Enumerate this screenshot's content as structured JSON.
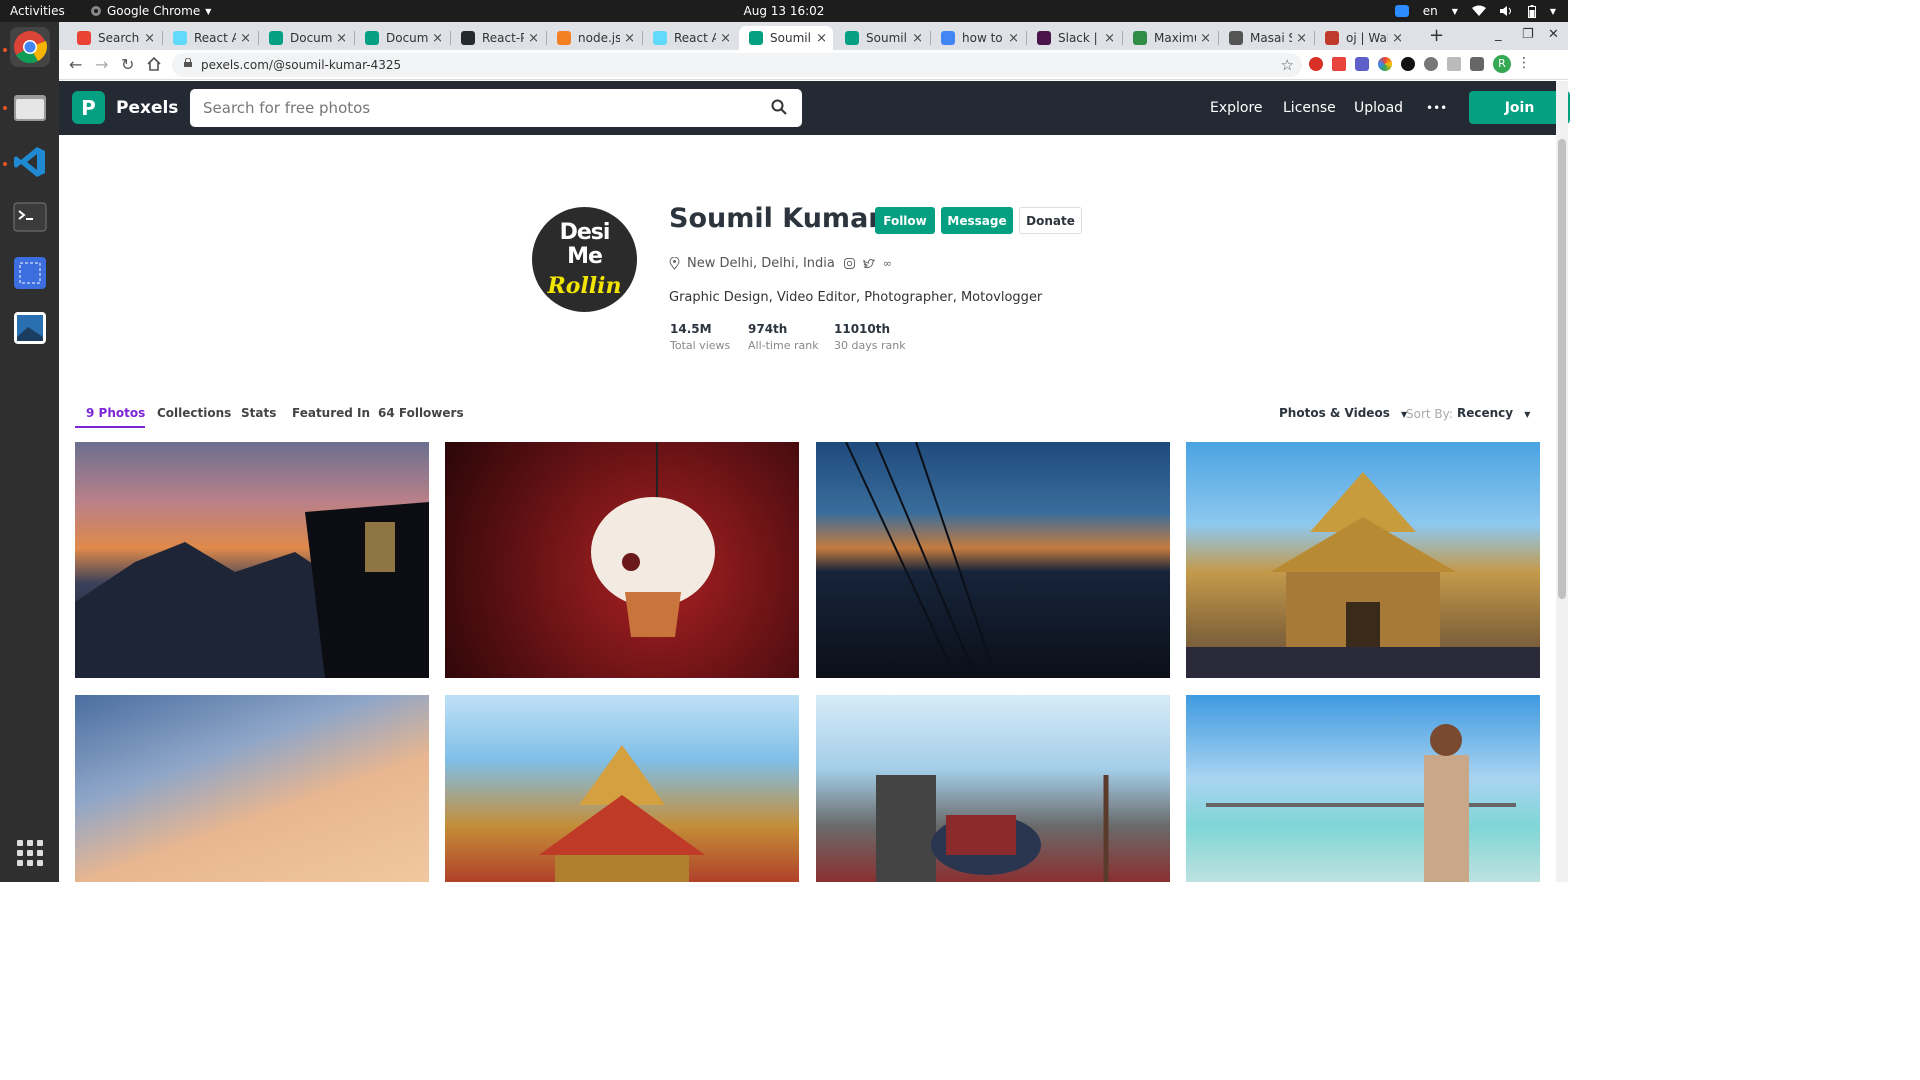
{
  "system_bar": {
    "activities": "Activities",
    "app_menu": "Google Chrome",
    "clock": "Aug 13  16:02",
    "lang": "en"
  },
  "tabs": [
    {
      "label": "Search r",
      "favicon": "gmail-icon",
      "color": "#ea4335",
      "active": false
    },
    {
      "label": "React Ap",
      "favicon": "react-icon",
      "color": "#61dafb",
      "active": false
    },
    {
      "label": "Docume",
      "favicon": "pexels-icon",
      "color": "#05a081",
      "active": false
    },
    {
      "label": "Docume",
      "favicon": "pexels-icon",
      "color": "#05a081",
      "active": false
    },
    {
      "label": "React-Pl",
      "favicon": "github-icon",
      "color": "#24292e",
      "active": false
    },
    {
      "label": "node.js",
      "favicon": "stackoverflow-icon",
      "color": "#f48024",
      "active": false
    },
    {
      "label": "React Ap",
      "favicon": "react-icon",
      "color": "#61dafb",
      "active": false
    },
    {
      "label": "Soumil K",
      "favicon": "pexels-icon",
      "color": "#05a081",
      "active": true
    },
    {
      "label": "Soumil K",
      "favicon": "pexels-icon",
      "color": "#05a081",
      "active": false
    },
    {
      "label": "how to i",
      "favicon": "google-icon",
      "color": "#4285f4",
      "active": false
    },
    {
      "label": "Slack | c",
      "favicon": "slack-icon",
      "color": "#4a154b",
      "active": false
    },
    {
      "label": "Maximu",
      "favicon": "gfg-icon",
      "color": "#2f8d46",
      "active": false
    },
    {
      "label": "Masai S",
      "favicon": "globe-icon",
      "color": "#555555",
      "active": false
    },
    {
      "label": "oj | Wall",
      "favicon": "pin-icon",
      "color": "#c0392b",
      "active": false
    }
  ],
  "address_bar": {
    "url": "pexels.com/@soumil-kumar-4325"
  },
  "header": {
    "logo_letter": "P",
    "logo_text": "Pexels",
    "search_placeholder": "Search for free photos",
    "nav": {
      "explore": "Explore",
      "license": "License",
      "upload": "Upload",
      "more": "•••"
    },
    "join": "Join"
  },
  "profile": {
    "avatar_line1": "Desi",
    "avatar_line2": "Me",
    "avatar_line3": "Rollin",
    "name": "Soumil Kumar",
    "buttons": {
      "follow": "Follow",
      "message": "Message",
      "donate": "Donate"
    },
    "location": "New Delhi, Delhi, India",
    "bio": "Graphic Design, Video Editor, Photographer, Motovlogger",
    "stats": [
      {
        "value": "14.5M",
        "label": "Total views"
      },
      {
        "value": "974th",
        "label": "All-time rank"
      },
      {
        "value": "11010th",
        "label": "30 days rank"
      }
    ]
  },
  "profile_tabs": {
    "photos": "9 Photos",
    "collections": "Collections",
    "stats": "Stats",
    "featured": "Featured In",
    "followers": "64 Followers"
  },
  "filters": {
    "media": "Photos & Videos",
    "sort_label": "Sort By:",
    "sort_value": "Recency"
  },
  "colors": {
    "brand": "#05a081",
    "header_bg": "#232a34",
    "active_tab": "#7c26d6"
  }
}
